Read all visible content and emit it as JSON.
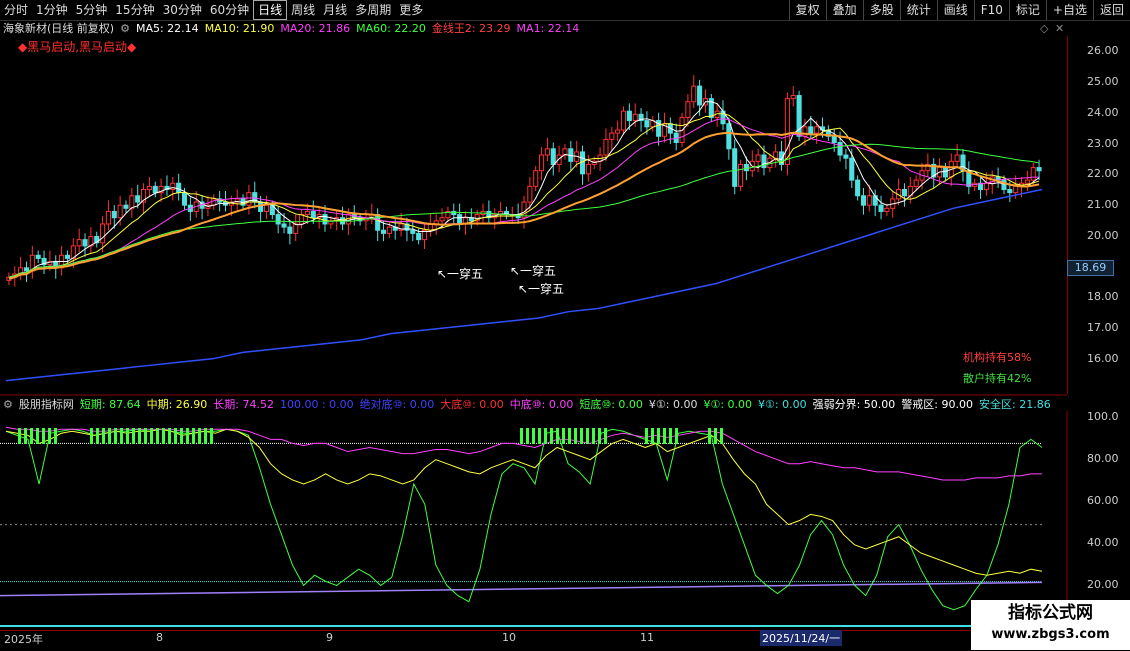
{
  "periods": [
    "分时",
    "1分钟",
    "5分钟",
    "15分钟",
    "30分钟",
    "60分钟",
    "日线",
    "周线",
    "月线",
    "多周期",
    "更多"
  ],
  "active_period": "日线",
  "right_buttons": [
    "复权",
    "叠加",
    "多股",
    "统计",
    "画线",
    "F10",
    "标记",
    "+自选",
    "返回"
  ],
  "stock_title": "海象新材(日线 前复权)",
  "ma": {
    "ma5": "MA5: 22.14",
    "ma10": "MA10: 21.90",
    "ma20": "MA20: 21.86",
    "ma60": "MA60: 22.20",
    "gold": "金线王2: 23.29",
    "ma1": "MA1: 22.14"
  },
  "signal_text": "◆黑马启动,黑马启动◆",
  "annotations": [
    "↖一穿五",
    "↖一穿五",
    "↖一穿五"
  ],
  "price_ticks": [
    "26.00",
    "25.00",
    "24.00",
    "23.00",
    "22.00",
    "21.00",
    "20.00",
    "19.00",
    "18.00",
    "17.00",
    "16.00"
  ],
  "current_price": "18.69",
  "holdings": {
    "inst": "机构持有58%",
    "retail": "散户持有42%"
  },
  "indicator": {
    "name": "股朋指标网",
    "short": "短期: 87.64",
    "mid": "中期: 26.90",
    "long": "长期: 74.52",
    "l100": "100.00 : 0.00",
    "abs_bottom": "绝对底⑩: 0.00",
    "big_bottom": "大底⑩: 0.00",
    "mid_bottom": "中底⑩: 0.00",
    "short_bottom": "短底⑩: 0.00",
    "y1": "¥①: 0.00",
    "y2": "¥①: 0.00",
    "y3": "¥①: 0.00",
    "strong_weak": "强弱分界: 50.00",
    "warn": "警戒区: 90.00",
    "safe": "安全区: 21.86"
  },
  "indicator_ticks": [
    "100.0",
    "80.00",
    "60.00",
    "40.00",
    "20.00"
  ],
  "dates": [
    "2025年",
    "8",
    "9",
    "10",
    "11"
  ],
  "date_highlight": "2025/11/24/一",
  "watermark": {
    "line1": "指标公式网",
    "line2": "www.zbgs3.com"
  },
  "colors": {
    "up": "#ff3030",
    "down": "#50e0e0",
    "ma5": "#ffffff",
    "ma10": "#ffff40",
    "ma20": "#ff40ff",
    "ma60": "#40ff40",
    "gold": "#ffa030",
    "ma_long": "#3050ff"
  },
  "chart_data": [
    {
      "type": "candlestick",
      "title": "海象新材(日线 前复权)",
      "ylim": [
        15.3,
        26.6
      ],
      "x": [
        0,
        1,
        2,
        3,
        4,
        5,
        6,
        7,
        8,
        9,
        10,
        11,
        12,
        13,
        14,
        15,
        16,
        17,
        18,
        19,
        20,
        21,
        22,
        23,
        24,
        25,
        26,
        27,
        28,
        29,
        30,
        31,
        32,
        33,
        34,
        35,
        36,
        37,
        38,
        39,
        40,
        41,
        42,
        43,
        44,
        45,
        46,
        47,
        48,
        49,
        50,
        51,
        52,
        53,
        54,
        55,
        56,
        57,
        58,
        59,
        60,
        61,
        62,
        63,
        64,
        65,
        66,
        67,
        68,
        69,
        70,
        71,
        72,
        73,
        74,
        75,
        76,
        77,
        78,
        79,
        80,
        81,
        82,
        83,
        84,
        85,
        86,
        87,
        88,
        89,
        90,
        91,
        92,
        93,
        94,
        95,
        96,
        97,
        98,
        99,
        100,
        101,
        102,
        103,
        104,
        105,
        106,
        107,
        108,
        109,
        110,
        111,
        112,
        113,
        114,
        115,
        116,
        117,
        118,
        119,
        120,
        121,
        122,
        123,
        124,
        125,
        126,
        127,
        128,
        129,
        130,
        131,
        132,
        133,
        134,
        135,
        136,
        137,
        138,
        139,
        140,
        141,
        142,
        143,
        144,
        145,
        146,
        147,
        148,
        149,
        150,
        151,
        152,
        153,
        154,
        155,
        156,
        157,
        158,
        159,
        160,
        161,
        162,
        163,
        164,
        165,
        166,
        167,
        168,
        169,
        170,
        171,
        172,
        173,
        174,
        175,
        176,
        177,
        178
      ],
      "close": [
        18.9,
        19.0,
        19.2,
        19.1,
        19.6,
        19.5,
        19.3,
        19.4,
        19.2,
        19.6,
        19.5,
        19.9,
        20.1,
        19.9,
        20.2,
        20.0,
        20.6,
        21.0,
        20.8,
        21.2,
        21.1,
        21.5,
        21.3,
        21.7,
        21.8,
        21.6,
        21.8,
        21.7,
        21.9,
        21.6,
        21.2,
        21.0,
        21.3,
        21.1,
        21.2,
        21.4,
        21.3,
        21.2,
        21.3,
        21.4,
        21.2,
        21.6,
        21.3,
        21.0,
        21.2,
        20.9,
        20.6,
        20.5,
        20.3,
        20.6,
        20.9,
        21.0,
        20.8,
        20.9,
        20.6,
        20.7,
        20.8,
        20.6,
        20.9,
        20.8,
        20.7,
        20.8,
        20.9,
        20.4,
        20.3,
        20.5,
        20.4,
        20.6,
        20.4,
        20.3,
        20.1,
        20.4,
        20.6,
        20.7,
        20.8,
        21.0,
        20.9,
        20.6,
        20.8,
        20.7,
        20.9,
        21.0,
        20.8,
        20.9,
        21.0,
        20.9,
        20.9,
        20.8,
        21.3,
        21.8,
        22.3,
        22.8,
        23.0,
        22.5,
        22.8,
        23.0,
        22.6,
        22.9,
        22.2,
        22.5,
        22.6,
        22.8,
        23.3,
        23.5,
        23.6,
        24.2,
        23.9,
        24.1,
        23.9,
        23.7,
        23.9,
        23.4,
        23.8,
        23.5,
        23.2,
        24.0,
        24.5,
        25.0,
        24.4,
        24.6,
        24.0,
        24.2,
        23.8,
        23.0,
        21.8,
        22.5,
        22.3,
        22.6,
        22.8,
        22.4,
        22.7,
        22.9,
        22.5,
        24.6,
        24.7,
        23.4,
        23.7,
        23.5,
        23.7,
        23.6,
        23.4,
        23.2,
        22.8,
        22.7,
        22.0,
        21.5,
        21.2,
        21.5,
        21.2,
        21.0,
        21.1,
        21.4,
        21.7,
        21.5,
        21.8,
        22.0,
        22.3,
        22.5,
        22.1,
        22.4,
        22.1,
        22.6,
        22.8,
        22.3,
        21.8,
        21.9,
        21.7,
        21.9,
        22.1,
        22.0,
        21.7,
        21.6,
        21.8,
        21.9,
        22.0,
        22.4,
        22.3
      ],
      "volume_note": "",
      "ma_long": [
        15.6,
        15.7,
        15.8,
        15.9,
        16.0,
        16.1,
        16.2,
        16.3,
        16.5,
        16.6,
        16.7,
        16.8,
        16.9,
        17.1,
        17.2,
        17.3,
        17.4,
        17.5,
        17.6,
        17.8,
        17.9,
        18.1,
        18.3,
        18.5,
        18.7,
        19.0,
        19.3,
        19.6,
        19.9,
        20.2,
        20.5,
        20.8,
        21.1,
        21.3,
        21.5,
        21.7
      ]
    },
    {
      "type": "line",
      "ylim": [
        0,
        105
      ],
      "series": [
        {
          "name": "短期",
          "values": [
            96,
            94,
            92,
            70,
            95,
            96,
            97,
            96,
            94,
            95,
            96,
            96,
            97,
            96,
            97,
            96,
            95,
            95,
            96,
            96,
            97,
            96,
            94,
            78,
            60,
            45,
            30,
            20,
            25,
            22,
            20,
            24,
            28,
            25,
            20,
            24,
            45,
            70,
            60,
            30,
            20,
            15,
            12,
            28,
            55,
            75,
            80,
            78,
            70,
            95,
            96,
            80,
            76,
            70,
            95,
            97,
            96,
            94,
            92,
            90,
            72,
            95,
            96,
            95,
            94,
            70,
            55,
            40,
            25,
            20,
            16,
            20,
            30,
            45,
            52,
            45,
            30,
            20,
            15,
            25,
            44,
            50,
            40,
            28,
            18,
            10,
            8,
            10,
            18,
            25,
            40,
            60,
            88,
            92,
            88
          ]
        },
        {
          "name": "中期",
          "values": [
            96,
            95,
            94,
            90,
            92,
            95,
            96,
            95,
            94,
            95,
            96,
            95,
            96,
            96,
            97,
            96,
            94,
            95,
            96,
            95,
            97,
            96,
            93,
            88,
            80,
            75,
            72,
            70,
            72,
            75,
            72,
            70,
            72,
            75,
            74,
            72,
            70,
            72,
            78,
            82,
            80,
            78,
            76,
            75,
            78,
            80,
            82,
            80,
            78,
            84,
            88,
            86,
            84,
            82,
            86,
            90,
            92,
            90,
            88,
            90,
            86,
            88,
            90,
            92,
            94,
            90,
            82,
            75,
            70,
            60,
            55,
            50,
            52,
            55,
            54,
            52,
            45,
            40,
            38,
            40,
            42,
            44,
            40,
            36,
            34,
            32,
            30,
            28,
            26,
            25,
            26,
            27,
            26,
            28,
            27
          ]
        },
        {
          "name": "长期",
          "values": [
            98,
            97,
            97,
            96,
            96,
            97,
            97,
            97,
            96,
            96,
            97,
            97,
            97,
            97,
            97,
            97,
            96,
            96,
            97,
            97,
            97,
            97,
            96,
            94,
            92,
            92,
            90,
            89,
            90,
            90,
            88,
            86,
            87,
            88,
            87,
            86,
            85,
            85,
            86,
            87,
            87,
            86,
            85,
            86,
            88,
            90,
            90,
            89,
            88,
            90,
            92,
            92,
            91,
            90,
            92,
            94,
            95,
            94,
            93,
            94,
            93,
            94,
            95,
            96,
            96,
            95,
            92,
            89,
            86,
            84,
            82,
            80,
            80,
            81,
            80,
            79,
            78,
            78,
            77,
            76,
            76,
            76,
            75,
            74,
            73,
            72,
            72,
            72,
            73,
            73,
            73,
            74,
            74,
            75,
            75
          ]
        }
      ]
    }
  ]
}
